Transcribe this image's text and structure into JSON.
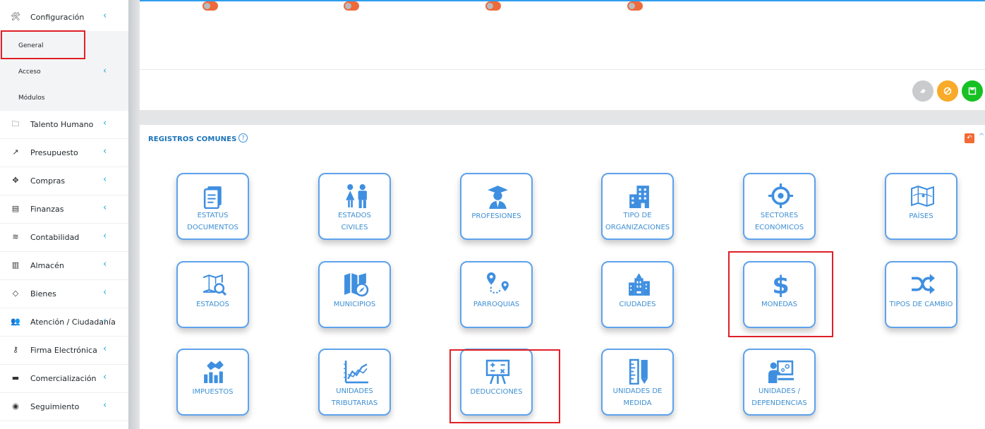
{
  "sidebar": {
    "configuracion": "Configuración",
    "sub": {
      "general": "General",
      "acceso": "Acceso",
      "modulos": "Módulos"
    },
    "items": [
      {
        "label": "Talento Humano",
        "icon": "folder-icon"
      },
      {
        "label": "Presupuesto",
        "icon": "trend-icon"
      },
      {
        "label": "Compras",
        "icon": "gift-icon"
      },
      {
        "label": "Finanzas",
        "icon": "document-icon"
      },
      {
        "label": "Contabilidad",
        "icon": "layers-icon"
      },
      {
        "label": "Almacén",
        "icon": "list-icon"
      },
      {
        "label": "Bienes",
        "icon": "tag-icon"
      },
      {
        "label": "Atención / Ciudadanía",
        "icon": "users-icon"
      },
      {
        "label": "Firma Electrónica",
        "icon": "key-icon"
      },
      {
        "label": "Comercialización",
        "icon": "briefcase-icon"
      },
      {
        "label": "Seguimiento",
        "icon": "globe-icon"
      }
    ]
  },
  "registros": {
    "title": "REGISTROS COMUNES",
    "help": "?",
    "tiles": [
      {
        "label": "ESTATUS\nDOCUMENTOS",
        "icon": "documents-icon"
      },
      {
        "label": "ESTADOS\nCIVILES",
        "icon": "couple-icon"
      },
      {
        "label": "PROFESIONES",
        "icon": "graduate-icon"
      },
      {
        "label": "TIPO DE\nORGANIZACIONES",
        "icon": "building-icon"
      },
      {
        "label": "SECTORES\nECONÓMICOS",
        "icon": "target-icon"
      },
      {
        "label": "PAÍSES",
        "icon": "map-icon"
      },
      {
        "label": "ESTADOS",
        "icon": "map-search-icon"
      },
      {
        "label": "MUNICIPIOS",
        "icon": "map-compass-icon"
      },
      {
        "label": "PARROQUIAS",
        "icon": "route-icon"
      },
      {
        "label": "CIUDADES",
        "icon": "city-icon"
      },
      {
        "label": "MONEDAS",
        "icon": "dollar-icon"
      },
      {
        "label": "TIPOS DE CAMBIO",
        "icon": "shuffle-icon"
      },
      {
        "label": "IMPUESTOS",
        "icon": "handshake-chart-icon"
      },
      {
        "label": "UNIDADES\nTRIBUTARIAS",
        "icon": "line-chart-icon"
      },
      {
        "label": "DEDUCCIONES",
        "icon": "math-board-icon"
      },
      {
        "label": "UNIDADES DE\nMEDIDA",
        "icon": "ruler-pencil-icon"
      },
      {
        "label": "UNIDADES /\nDEPENDENCIAS",
        "icon": "presenter-icon"
      }
    ]
  },
  "colors": {
    "accent": "#3d8fd3",
    "tile_border": "#5da2ec",
    "highlight": "#e01f27",
    "toggle": "#ef6a3b"
  }
}
